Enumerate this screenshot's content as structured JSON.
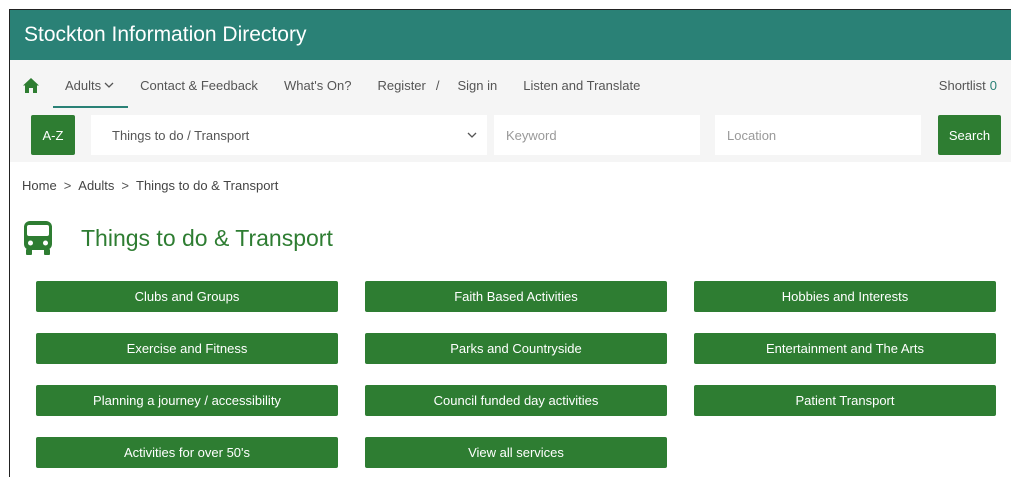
{
  "app": {
    "title": "Stockton Information Directory"
  },
  "nav": {
    "items": [
      {
        "label": "Adults"
      },
      {
        "label": "Contact & Feedback"
      },
      {
        "label": "What's On?"
      },
      {
        "label": "Register"
      },
      {
        "label": "Sign in"
      },
      {
        "label": "Listen and Translate"
      }
    ],
    "slash": "/",
    "shortlist_label": "Shortlist",
    "shortlist_count": "0"
  },
  "search": {
    "az_label": "A-Z",
    "category_value": "Things to do / Transport",
    "keyword_placeholder": "Keyword",
    "location_placeholder": "Location",
    "search_label": "Search"
  },
  "breadcrumb": {
    "items": [
      "Home",
      "Adults",
      "Things to do & Transport"
    ],
    "separator": ">"
  },
  "page": {
    "title": "Things to do & Transport"
  },
  "categories": [
    "Clubs and Groups",
    "Faith Based Activities",
    "Hobbies and Interests",
    "Exercise and Fitness",
    "Parks and Countryside",
    "Entertainment and The Arts",
    "Planning a journey / accessibility",
    "Council funded day activities",
    "Patient Transport",
    "Activities for over 50's",
    "View all services"
  ],
  "colors": {
    "header_teal": "#2a8176",
    "button_green": "#2e7d32"
  }
}
